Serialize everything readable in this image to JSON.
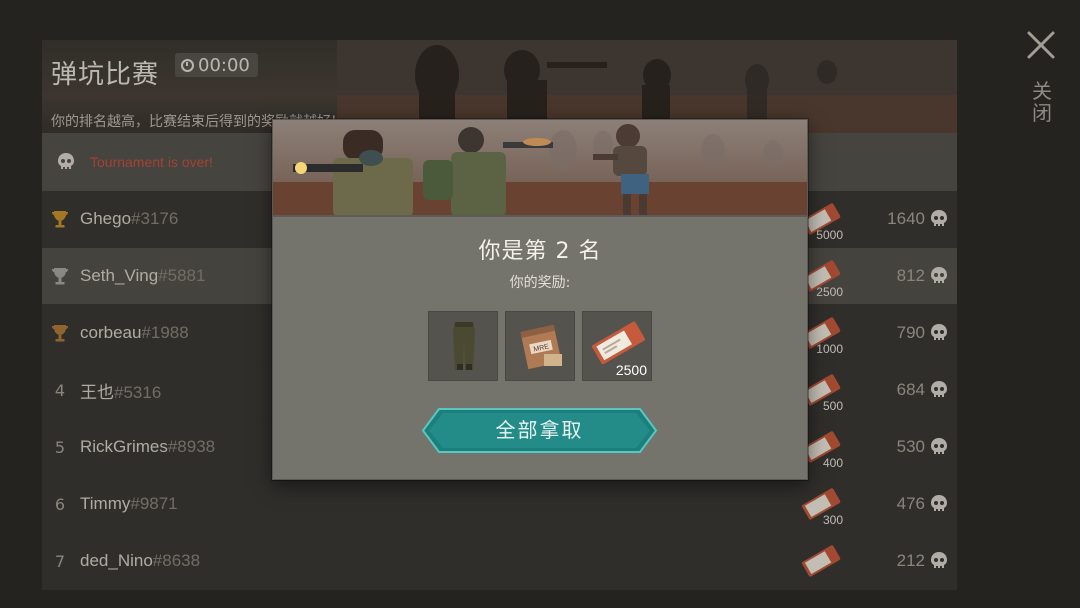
{
  "header": {
    "title": "弹坑比赛",
    "timer": "00:00",
    "subtitle": "你的排名越高，比赛结束后得到的奖励就越好!"
  },
  "status": {
    "text": "Tournament is over!",
    "icon": "skull-icon",
    "color": "#c9503f"
  },
  "close": {
    "label": "关闭",
    "icon": "close-icon"
  },
  "leaderboard": [
    {
      "rank": "1",
      "rank_icon": "gold-trophy-icon",
      "name": "Ghego",
      "tag": "#3176",
      "reward": "5000",
      "score": "1640"
    },
    {
      "rank": "2",
      "rank_icon": "silver-trophy-icon",
      "name": "Seth_Ving",
      "tag": "#5881",
      "reward": "2500",
      "score": "812"
    },
    {
      "rank": "3",
      "rank_icon": "bronze-trophy-icon",
      "name": "corbeau",
      "tag": "#1988",
      "reward": "1000",
      "score": "790"
    },
    {
      "rank": "4",
      "name": "王也",
      "tag": "#5316",
      "reward": "500",
      "score": "684"
    },
    {
      "rank": "5",
      "name": "RickGrimes",
      "tag": "#8938",
      "reward": "400",
      "score": "530"
    },
    {
      "rank": "6",
      "name": "Timmy",
      "tag": "#9871",
      "reward": "300",
      "score": "476"
    },
    {
      "rank": "7",
      "name": "ded_Nino",
      "tag": "#8638",
      "reward": "",
      "score": "212"
    }
  ],
  "modal": {
    "title": "你是第 2 名",
    "subtitle": "你的奖励:",
    "items": [
      {
        "name": "pants",
        "icon": "pants-icon",
        "amount": ""
      },
      {
        "name": "mre",
        "icon": "mre-ration-icon",
        "amount": ""
      },
      {
        "name": "ticket",
        "icon": "ticket-icon",
        "amount": "2500"
      }
    ],
    "claim_label": "全部拿取",
    "accent": "#1f8a86"
  }
}
